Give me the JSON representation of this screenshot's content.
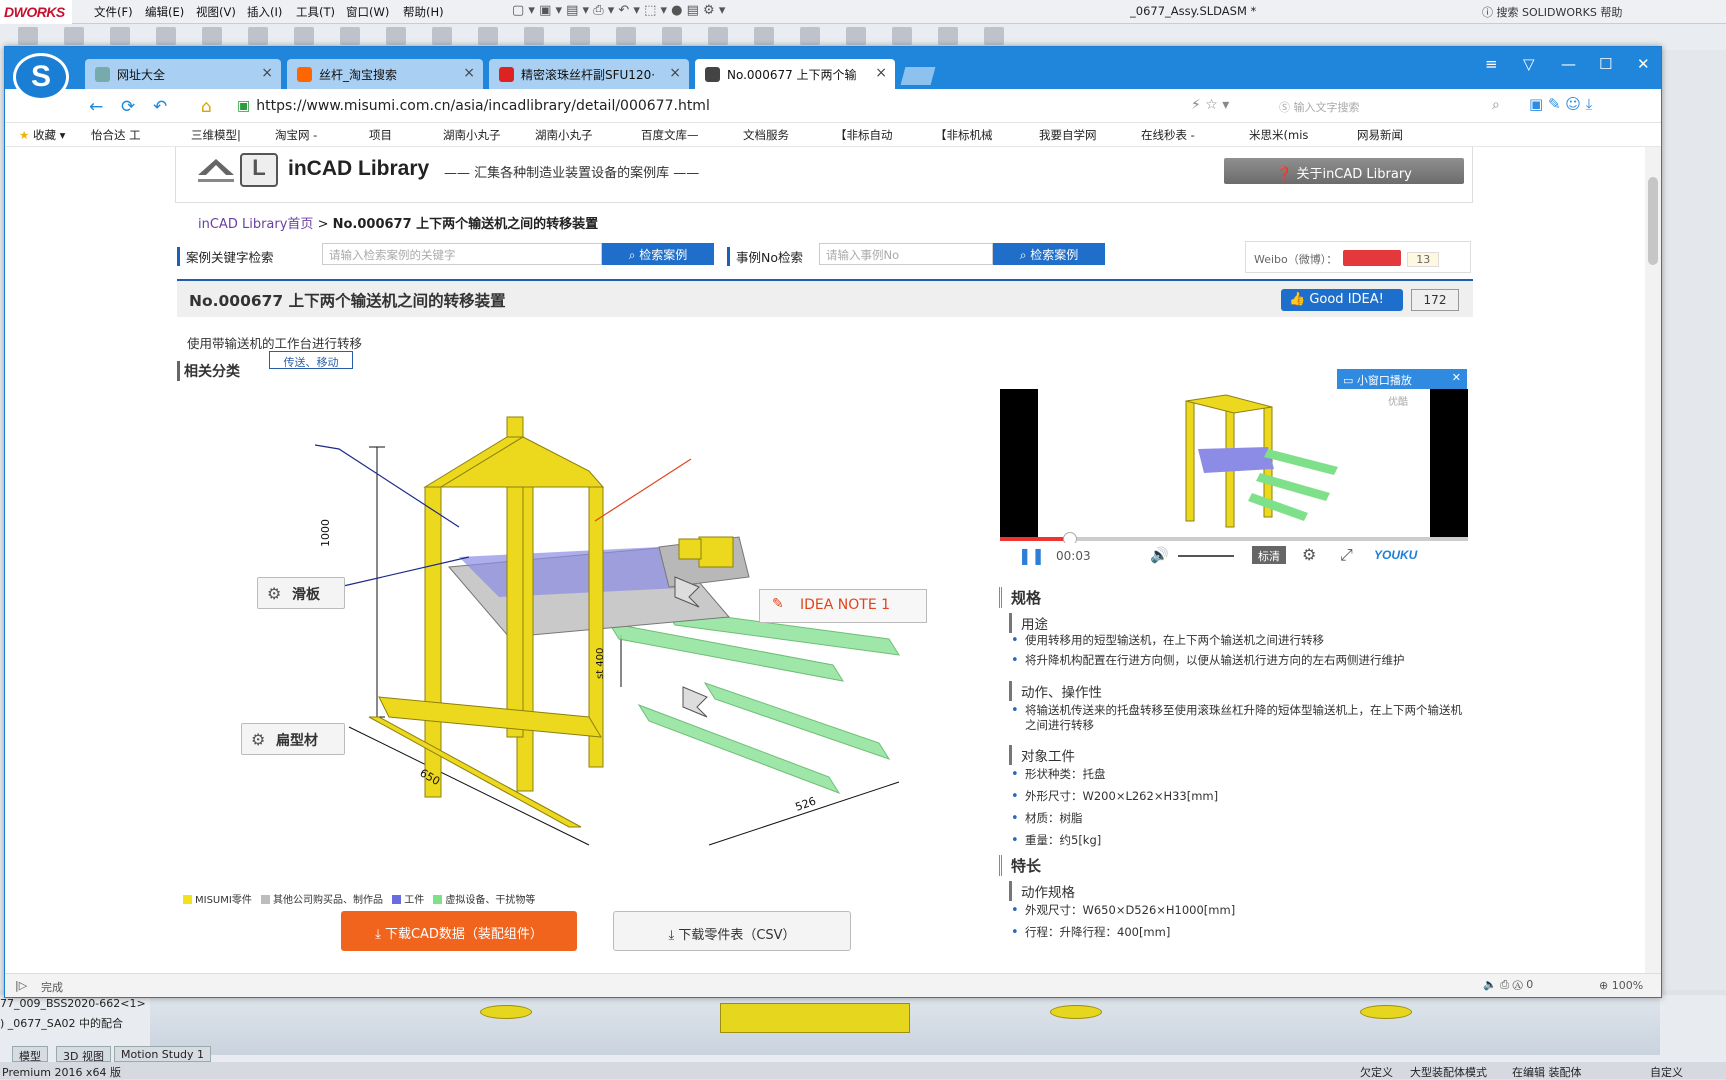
{
  "sw": {
    "logo": "DWORKS",
    "menus": [
      "文件(F)",
      "编辑(E)",
      "视图(V)",
      "插入(I)",
      "工具(T)",
      "窗口(W)",
      "帮助(H)"
    ],
    "title": "_0677_Assy.SLDASM *",
    "help_search": "搜索 SOLIDWORKS 帮助",
    "tree_items": [
      "77_009_BSS2020-662<1>",
      ") _0677_SA02 中的配合"
    ],
    "tabs": [
      "模型",
      "3D 视图",
      "Motion Study 1"
    ],
    "status_left": "Premium 2016 x64 版",
    "status_right": [
      "欠定义",
      "大型装配体模式",
      "在编辑 装配体",
      "自定义"
    ]
  },
  "browser": {
    "brand": "S",
    "tabs": [
      {
        "label": "网址大全",
        "color": "#7aa"
      },
      {
        "label": "丝杆_淘宝搜索",
        "color": "#f60"
      },
      {
        "label": "精密滚珠丝杆副SFU120·",
        "color": "#d22"
      },
      {
        "label": "No.000677 上下两个输",
        "color": "#444"
      }
    ],
    "url": "https://www.misumi.com.cn/asia/incadlibrary/detail/000677.html",
    "search_placeholder": "输入文字搜索",
    "bookmarks": [
      "收藏",
      "怡合达 工",
      "三维模型|",
      "淘宝网 -",
      "项目",
      "湖南小丸子",
      "湖南小丸子",
      "百度文库—",
      "文档服务",
      "【非标自动",
      "【非标机械",
      "我要自学网",
      "在线秒表 -",
      "米思米(mis",
      "网易新闻"
    ],
    "status": "完成",
    "zoom": "100%",
    "status_count": "0"
  },
  "page": {
    "header": {
      "title": "inCAD Library",
      "tagline": "—— 汇集各种制造业装置设备的案例库 ——",
      "about": "关于inCAD Library"
    },
    "breadcrumb": {
      "home": "inCAD Library首页",
      "sep": ">",
      "current": "No.000677 上下两个输送机之间的转移装置"
    },
    "search": {
      "kw_label": "案例关键字检索",
      "kw_placeholder": "请输入检索案例的关键字",
      "kw_button": "检索案例",
      "no_label": "事例No检索",
      "no_placeholder": "请输入事例No",
      "no_button": "检索案例",
      "weibo": "Weibo（微博）：",
      "weibo_count": "13"
    },
    "title": "No.000677 上下两个输送机之间的转移装置",
    "good": "Good IDEA!",
    "good_count": "172",
    "desc": "使用带输送机的工作台进行转移",
    "related": "相关分类",
    "tag": "传送、移动",
    "callouts": {
      "a": "滑板",
      "b": "扁型材",
      "idea": "IDEA NOTE 1"
    },
    "dims": {
      "h": "1000",
      "w": "650",
      "d": "526",
      "st": "st 400"
    },
    "legend": [
      {
        "label": "MISUMI零件",
        "color": "#f2e21a"
      },
      {
        "label": "其他公司购买品、制作品",
        "color": "#bdbdbd"
      },
      {
        "label": "工件",
        "color": "#6b6be0"
      },
      {
        "label": "虚拟设备、干扰物等",
        "color": "#7fe08a"
      }
    ],
    "dl_cad": "下载CAD数据（装配组件）",
    "dl_csv": "下载零件表（CSV）",
    "video": {
      "popout": "小窗口播放",
      "time": "00:03",
      "quality": "标清",
      "brand": "YOUKU",
      "progress": 0.15,
      "overlay": "优酷"
    },
    "spec": {
      "h_spec": "规格",
      "h_use": "用途",
      "use": [
        "使用转移用的短型输送机，在上下两个输送机之间进行转移",
        "将升降机构配置在行进方向侧，以便从输送机行进方向的左右两侧进行维护"
      ],
      "h_action": "动作、操作性",
      "action": [
        "将输送机传送来的托盘转移至使用滚珠丝杠升降的短体型输送机上，在上下两个输送机之间进行转移"
      ],
      "h_work": "对象工件",
      "work": [
        "形状种类：托盘",
        "外形尺寸：W200×L262×H33[mm]",
        "材质：树脂",
        "重量：约5[kg]"
      ],
      "h_feature": "特长",
      "h_motion": "动作规格",
      "motion": [
        "外观尺寸：W650×D526×H1000[mm]",
        "行程：升降行程：400[mm]"
      ]
    }
  }
}
